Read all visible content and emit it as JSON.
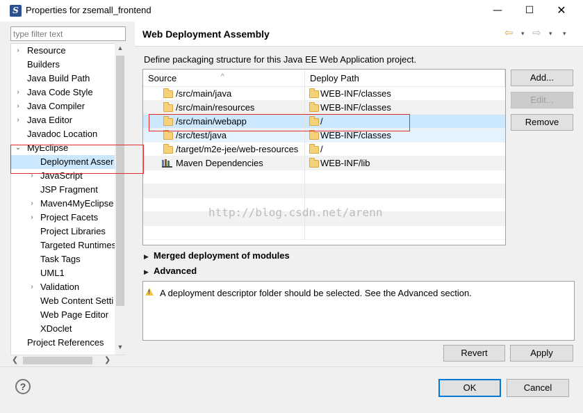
{
  "window": {
    "title": "Properties for zsemall_frontend",
    "minimize": "—",
    "maximize": "☐",
    "close": "✕"
  },
  "filter": {
    "placeholder": "type filter text"
  },
  "tree": {
    "items": [
      {
        "label": "Resource",
        "arrow": "›"
      },
      {
        "label": "Builders",
        "arrow": ""
      },
      {
        "label": "Java Build Path",
        "arrow": ""
      },
      {
        "label": "Java Code Style",
        "arrow": "›"
      },
      {
        "label": "Java Compiler",
        "arrow": "›"
      },
      {
        "label": "Java Editor",
        "arrow": "›"
      },
      {
        "label": "Javadoc Location",
        "arrow": ""
      },
      {
        "label": "MyEclipse",
        "arrow": "⌄"
      },
      {
        "label": "Deployment Asser",
        "arrow": ""
      },
      {
        "label": "JavaScript",
        "arrow": "›"
      },
      {
        "label": "JSP Fragment",
        "arrow": ""
      },
      {
        "label": "Maven4MyEclipse",
        "arrow": "›"
      },
      {
        "label": "Project Facets",
        "arrow": "›"
      },
      {
        "label": "Project Libraries",
        "arrow": ""
      },
      {
        "label": "Targeted Runtimes",
        "arrow": ""
      },
      {
        "label": "Task Tags",
        "arrow": ""
      },
      {
        "label": "UML1",
        "arrow": ""
      },
      {
        "label": "Validation",
        "arrow": "›"
      },
      {
        "label": "Web Content Setti",
        "arrow": ""
      },
      {
        "label": "Web Page Editor",
        "arrow": ""
      },
      {
        "label": "XDoclet",
        "arrow": ""
      },
      {
        "label": "Project References",
        "arrow": ""
      }
    ]
  },
  "page": {
    "title": "Web Deployment Assembly",
    "description": "Define packaging structure for this Java EE Web Application project.",
    "nav_back": "⇦",
    "nav_forward": "⇨",
    "nav_dropdown": "▾",
    "nav_menu": "▾"
  },
  "table": {
    "headers": {
      "source": "Source",
      "deploy": "Deploy Path"
    },
    "rows": [
      {
        "source": "/src/main/java",
        "deploy": "WEB-INF/classes",
        "icon": "folder-icon"
      },
      {
        "source": "/src/main/resources",
        "deploy": "WEB-INF/classes",
        "icon": "folder-icon"
      },
      {
        "source": "/src/main/webapp",
        "deploy": "/",
        "icon": "folder-icon"
      },
      {
        "source": "/src/test/java",
        "deploy": "WEB-INF/classes",
        "icon": "folder-icon"
      },
      {
        "source": "/target/m2e-jee/web-resources",
        "deploy": "/",
        "icon": "folder-icon"
      },
      {
        "source": "Maven Dependencies",
        "deploy": "WEB-INF/lib",
        "icon": "maven-library-icon"
      }
    ]
  },
  "buttons": {
    "add": "Add...",
    "edit": "Edit...",
    "remove": "Remove",
    "revert": "Revert",
    "apply": "Apply",
    "ok": "OK",
    "cancel": "Cancel",
    "help": "?"
  },
  "sections": {
    "merged": "Merged deployment of modules",
    "advanced": "Advanced"
  },
  "message": "A deployment descriptor folder should be selected. See the Advanced section.",
  "watermark": "http://blog.csdn.net/arenn",
  "colors": {
    "selection": "#cce8ff",
    "annotation_red": "#e52b2b",
    "default_button_border": "#0078d7",
    "folder": "#f5d17a"
  }
}
